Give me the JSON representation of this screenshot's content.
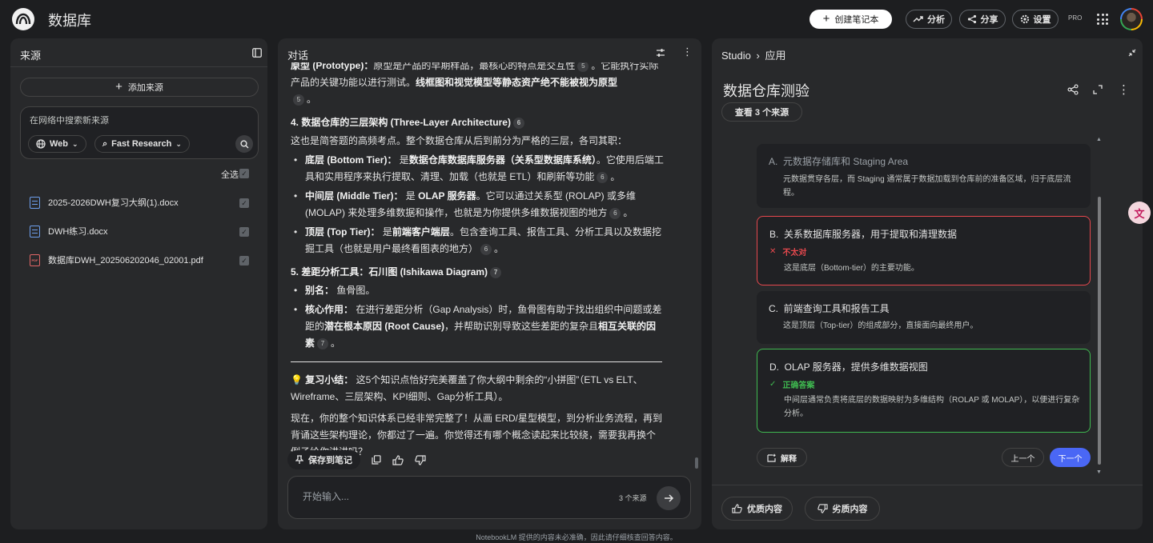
{
  "header": {
    "title": "数据库",
    "create_label": "创建笔记本",
    "analyze_label": "分析",
    "share_label": "分享",
    "settings_label": "设置",
    "pro_badge": "PRO"
  },
  "sources": {
    "title": "来源",
    "add_label": "添加来源",
    "search_placeholder": "在网络中搜索新来源",
    "web_chip": "Web",
    "research_chip": "Fast Research",
    "select_all": "全选",
    "items": [
      {
        "name": "2025-2026DWH复习大纲(1).docx",
        "icon": "doc-icon"
      },
      {
        "name": "DWH练习.docx",
        "icon": "doc-icon"
      },
      {
        "name": "数据库DWH_202506202046_02001.pdf",
        "icon": "pdf-icon"
      }
    ]
  },
  "chat": {
    "title": "对话",
    "p0a": "原型 (Prototype)：",
    "p0b": "原型是产品的早期样品，最核心的特点是交互性",
    "p0c": "。它能执行实际产品的关键功能以进行测试。",
    "p0d": "线框图和视觉模型等静态资产绝不能被视为原型",
    "h4": "4. 数据仓库的三层架构 (Three-Layer Architecture)",
    "p4": "这也是简答题的高频考点。整个数据仓库从后到前分为严格的三层，各司其职：",
    "b1a": "底层 (Bottom Tier)：",
    "b1b": "是",
    "b1c": "数据仓库数据库服务器（关系型数据库系统）",
    "b1d": "。它使用后端工具和实用程序来执行提取、清理、加载（也就是 ETL）和刷新等功能",
    "b2a": "中间层 (Middle Tier)：",
    "b2b": "是",
    "b2c": "OLAP 服务器",
    "b2d": "。它可以通过关系型 (ROLAP) 或多维 (MOLAP) 来处理多维数据和操作，也就是为你提供多维数据视图的地方",
    "b3a": "顶层 (Top Tier)：",
    "b3b": "是",
    "b3c": "前端客户端层",
    "b3d": "。包含查询工具、报告工具、分析工具以及数据挖掘工具（也就是用户最终看图表的地方）",
    "h5": "5. 差距分析工具：石川图 (Ishikawa Diagram)",
    "b4a": "别名：",
    "b4b": "鱼骨图。",
    "b5a": "核心作用：",
    "b5b": "在进行差距分析（Gap Analysis）时，鱼骨图有助于找出组织中间题或差距的",
    "b5c": "潜在根本原因 (Root Cause)",
    "b5d": "，并帮助识别导致这些差距的复杂且",
    "b5e": "相互关联的因素",
    "tip_emoji": "💡",
    "tip_a": "复习小结：",
    "tip_b": "这5个知识点恰好完美覆盖了你大纲中剩余的“小拼图”（ETL vs ELT、Wireframe、三层架构、KPI细则、Gap分析工具）。",
    "closing": "现在，你的整个知识体系已经非常完整了！从画 ERD/星型模型，到分析业务流程，再到背诵这些架构理论，你都过了一遍。你觉得还有哪个概念读起来比较绕，需要我再换个例子给你讲讲吗？",
    "cite5": "5",
    "cite6": "6",
    "cite7": "7",
    "period": "。",
    "save_label": "保存到笔记",
    "input_placeholder": "开始输入...",
    "source_count": "3 个来源"
  },
  "studio": {
    "crumb1": "Studio",
    "crumb2": "应用",
    "quiz_title": "数据仓库测验",
    "view_sources": "查看 3 个来源",
    "options": [
      {
        "letter": "A.",
        "text": "元数据存储库和 Staging Area",
        "note": "元数据贯穿各层，而 Staging 通常属于数据加载到仓库前的准备区域，归于底层流程。"
      },
      {
        "letter": "B.",
        "text": "关系数据库服务器，用于提取和清理数据",
        "status": "不太对",
        "note": "这是底层（Bottom-tier）的主要功能。"
      },
      {
        "letter": "C.",
        "text": "前端查询工具和报告工具",
        "note": "这是顶层（Top-tier）的组成部分，直接面向最终用户。"
      },
      {
        "letter": "D.",
        "text": "OLAP 服务器，提供多维数据视图",
        "status": "正确答案",
        "note": "中间层通常负责将底层的数据映射为多维结构（ROLAP 或 MOLAP），以便进行复杂分析。"
      }
    ],
    "explain_label": "解释",
    "prev_label": "上一个",
    "next_label": "下一个",
    "good_label": "优质内容",
    "bad_label": "劣质内容",
    "colors": {
      "wrong": "#e5484d",
      "correct": "#3fb950",
      "accent": "#4a67f5"
    }
  },
  "footer": "NotebookLM 提供的内容未必准确，因此请仔细核查回答内容。"
}
